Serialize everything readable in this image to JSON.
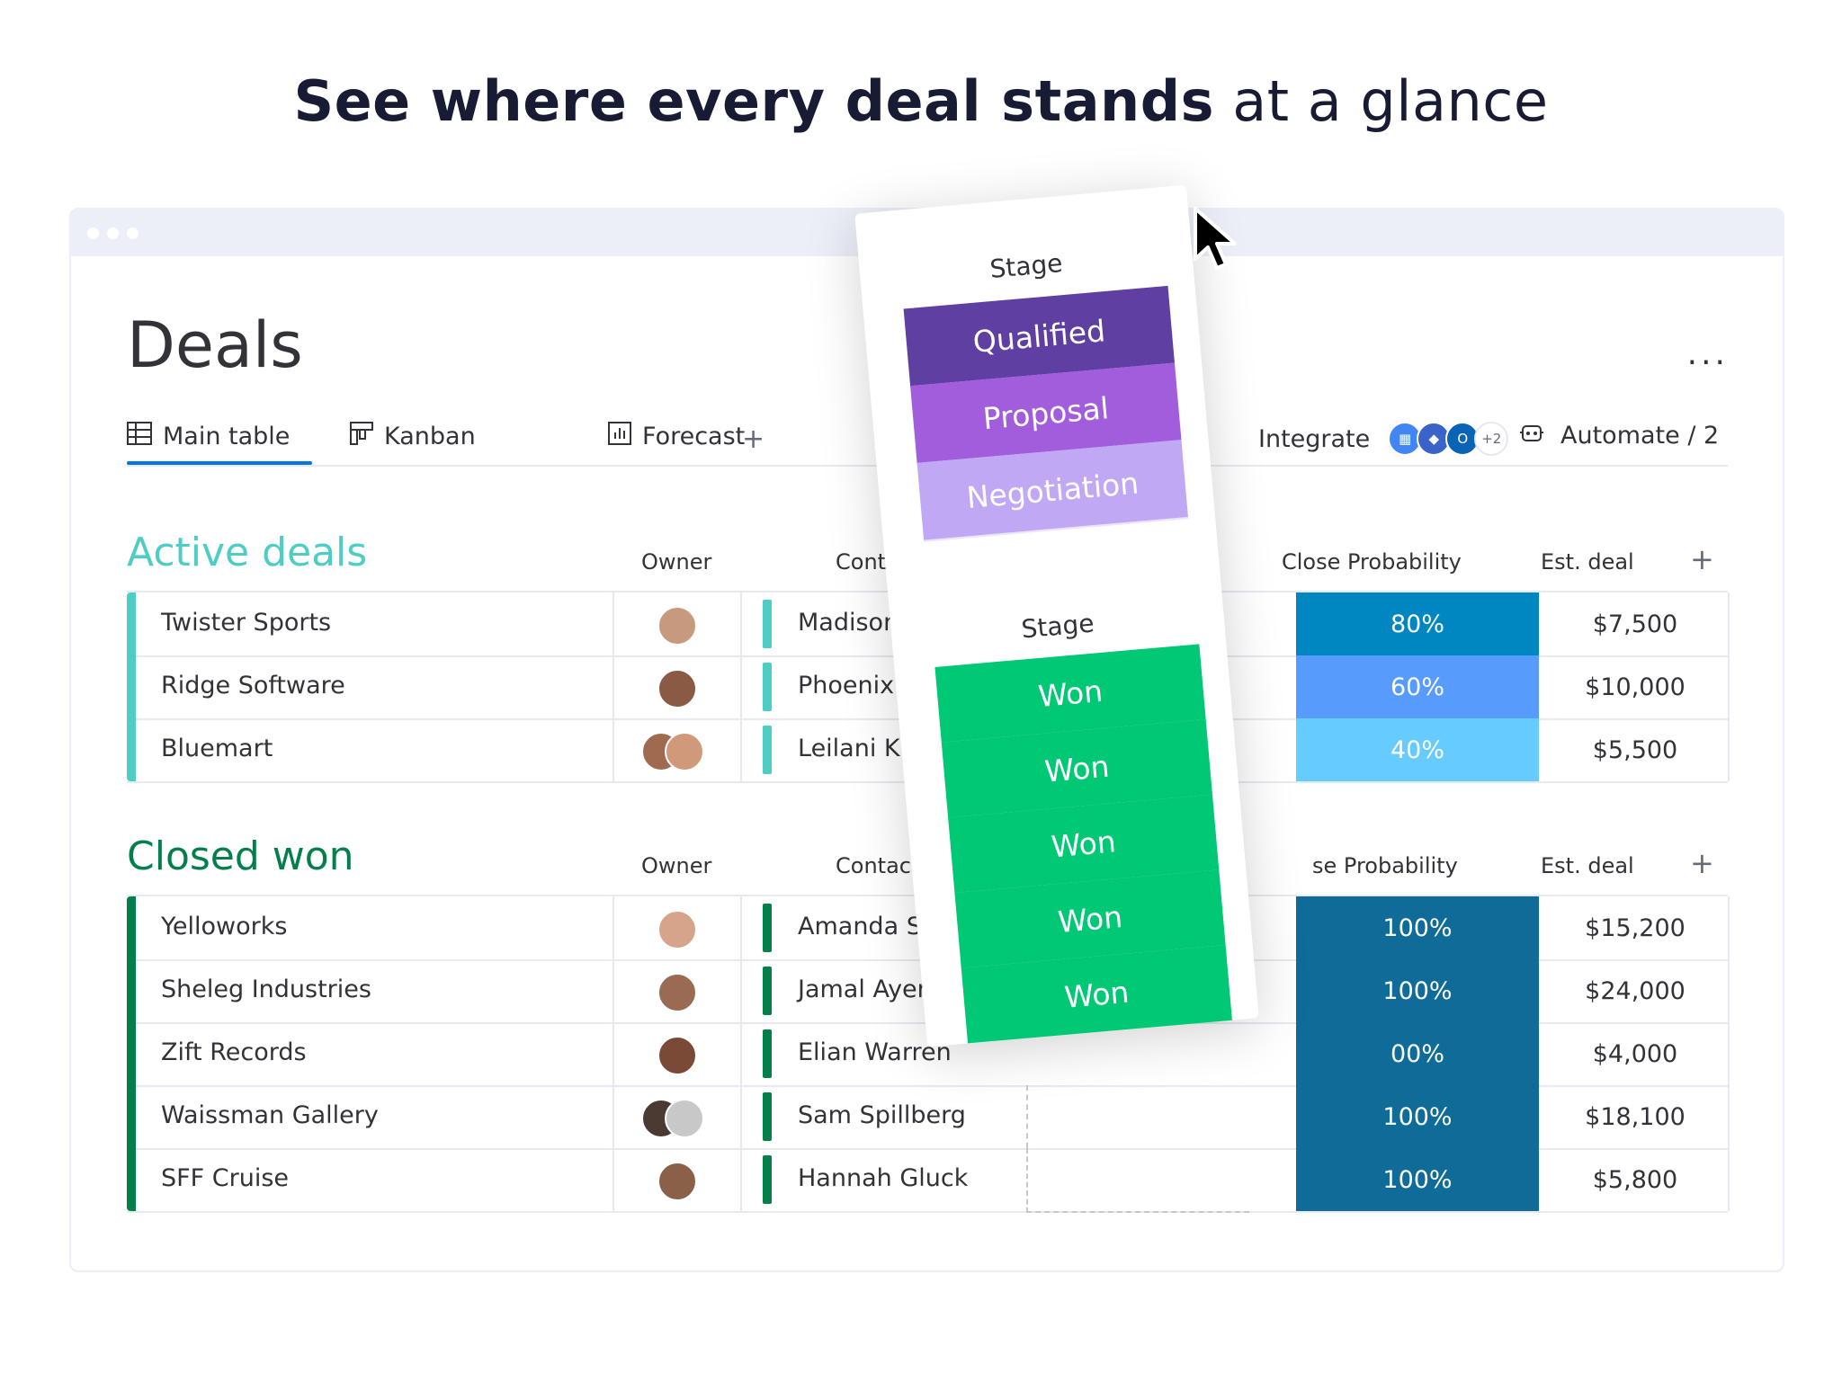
{
  "headline": {
    "bold": "See where every deal stands",
    "light": "at a glance"
  },
  "page": {
    "title": "Deals",
    "more": "..."
  },
  "tabs": [
    {
      "label": "Main table",
      "icon": "table-icon",
      "active": true
    },
    {
      "label": "Kanban",
      "icon": "kanban-icon"
    },
    {
      "label": "Forecast",
      "icon": "chart-icon"
    }
  ],
  "add_tab": "+",
  "integrate": {
    "label": "Integrate",
    "more_count": "+2"
  },
  "automate": {
    "label": "Automate / 2"
  },
  "columns": {
    "owner": "Owner",
    "contacts": "Contacts",
    "close_probability": "Close Probability",
    "est_deal": "Est. deal",
    "add": "+"
  },
  "active_group": {
    "title": "Active deals",
    "color": "#4ecdc4",
    "rows": [
      {
        "name": "Twister Sports",
        "contact": "Madison Doy",
        "probability": "80%",
        "prob_color": "#0086c0",
        "est": "$7,500"
      },
      {
        "name": "Ridge Software",
        "contact": "Phoenix Levy",
        "probability": "60%",
        "prob_color": "#579bfc",
        "est": "$10,000"
      },
      {
        "name": "Bluemart",
        "contact": "Leilani Krause",
        "probability": "40%",
        "prob_color": "#66ccff",
        "est": "$5,500"
      }
    ]
  },
  "closed_group": {
    "title": "Closed won",
    "color": "#037f4c",
    "close_probability_partial": "se Probability",
    "rows": [
      {
        "name": "Yelloworks",
        "contact": "Amanda Smith",
        "probability": "100%",
        "est": "$15,200"
      },
      {
        "name": "Sheleg Industries",
        "contact": "Jamal Ayers",
        "probability": "100%",
        "est": "$24,000"
      },
      {
        "name": "Zift Records",
        "contact": "Elian Warren",
        "probability": "00%",
        "est": "$4,000"
      },
      {
        "name": "Waissman Gallery",
        "contact": "Sam Spillberg",
        "probability": "100%",
        "est": "$18,100"
      },
      {
        "name": "SFF Cruise",
        "contact": "Hannah Gluck",
        "probability": "100%",
        "est": "$5,800"
      }
    ],
    "prob_color": "#0f6b98"
  },
  "stage_card": {
    "label_top": "Stage",
    "top_chips": [
      {
        "label": "Qualified",
        "color": "#5f3fa2"
      },
      {
        "label": "Proposal",
        "color": "#a25ddc"
      },
      {
        "label": "Negotiation",
        "color": "#c0a8f5"
      }
    ],
    "label_bottom": "Stage",
    "bottom_chips": [
      {
        "label": "Won",
        "color": "#00c875"
      },
      {
        "label": "Won",
        "color": "#00c875"
      },
      {
        "label": "Won",
        "color": "#00c875"
      },
      {
        "label": "Won",
        "color": "#00c875"
      },
      {
        "label": "Won",
        "color": "#00c875"
      }
    ]
  }
}
